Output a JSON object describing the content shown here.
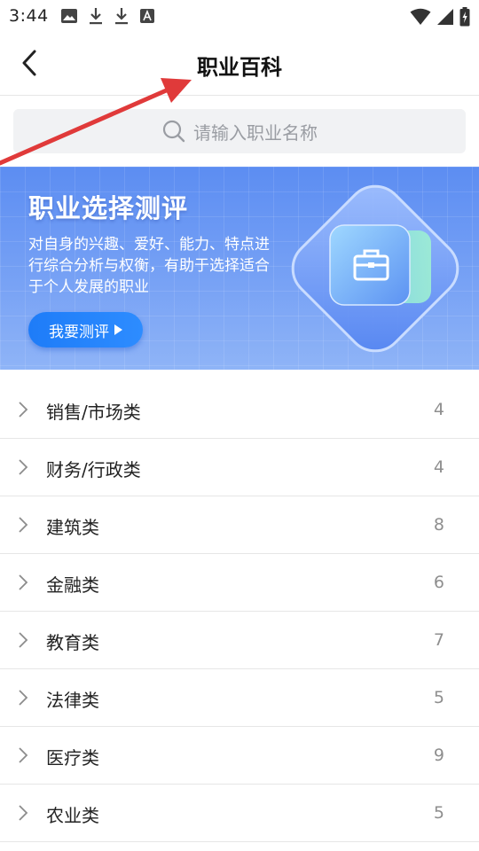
{
  "status_bar": {
    "time": "3:44",
    "icons_left": [
      "image-icon",
      "download-icon",
      "download-icon",
      "text-a-icon"
    ],
    "icons_right": [
      "wifi-icon",
      "signal-icon",
      "battery-charging-icon"
    ]
  },
  "header": {
    "title": "职业百科",
    "back_icon": "chevron-left-icon"
  },
  "search": {
    "placeholder": "请输入职业名称"
  },
  "banner": {
    "title": "职业选择测评",
    "description": "对自身的兴趣、爱好、能力、特点进行综合分析与权衡，有助于选择适合于个人发展的职业",
    "button_label": "我要测评",
    "button_icon": "play-triangle-icon",
    "art_icon": "briefcase-icon",
    "colors": {
      "background": "#6f9bf4",
      "button": "#1e7cf8"
    }
  },
  "categories": [
    {
      "label": "销售/市场类",
      "count": "4"
    },
    {
      "label": "财务/行政类",
      "count": "4"
    },
    {
      "label": "建筑类",
      "count": "8"
    },
    {
      "label": "金融类",
      "count": "6"
    },
    {
      "label": "教育类",
      "count": "7"
    },
    {
      "label": "法律类",
      "count": "5"
    },
    {
      "label": "医疗类",
      "count": "9"
    },
    {
      "label": "农业类",
      "count": "5"
    }
  ],
  "annotation": {
    "type": "arrow",
    "color": "#e03a3a"
  }
}
